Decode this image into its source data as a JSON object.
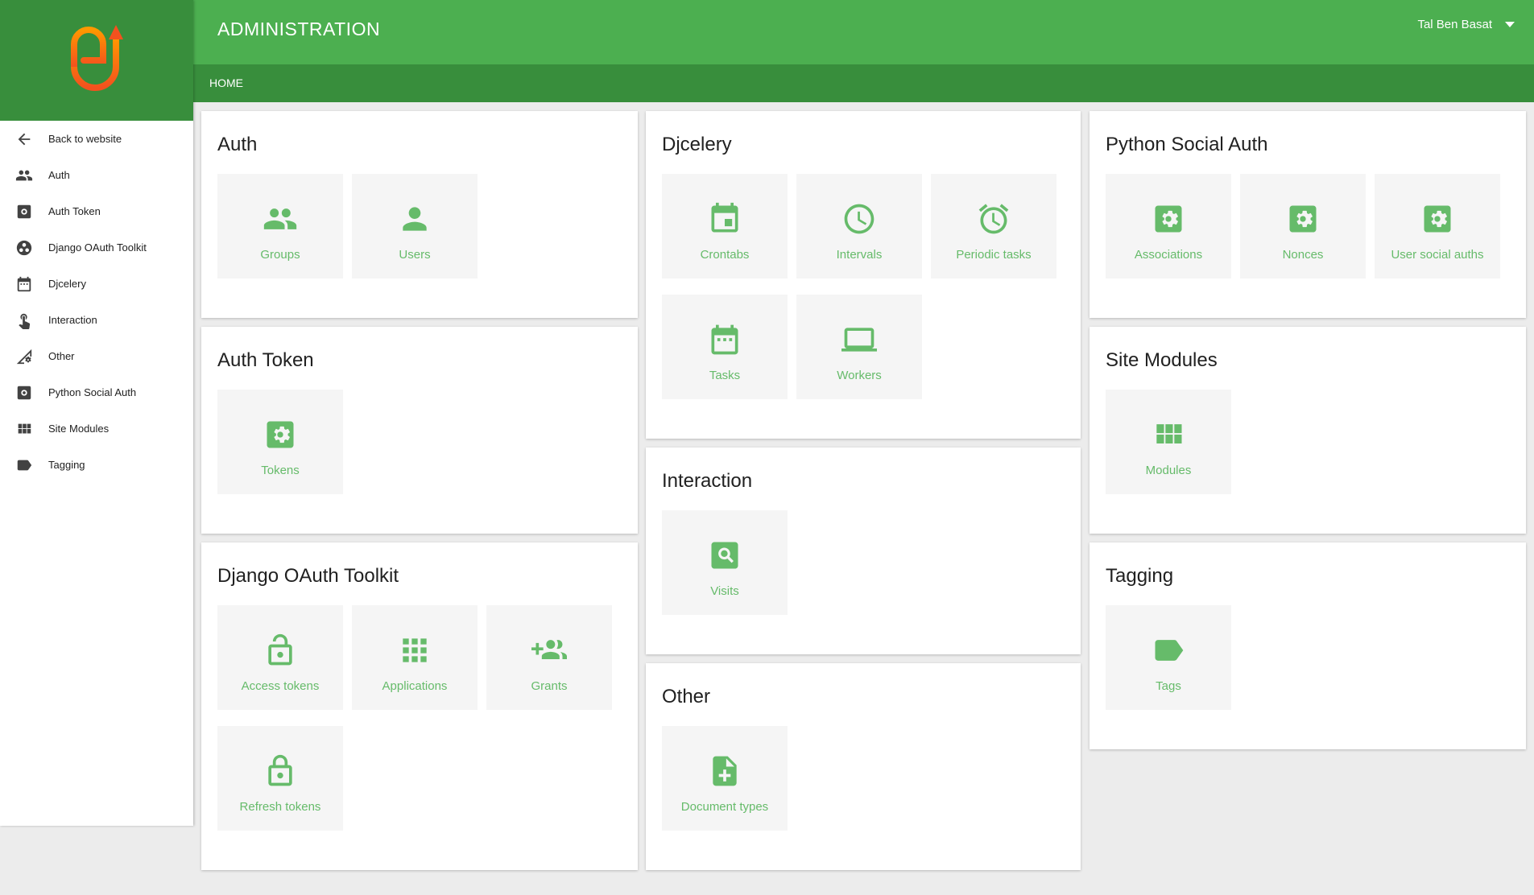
{
  "colors": {
    "header": "#4caf50",
    "subbar": "#388e3c",
    "accent": "#66bb6a",
    "tile_bg": "#f5f5f5",
    "page_bg": "#ececec"
  },
  "header": {
    "title": "ADMINISTRATION",
    "user_name": "Tal Ben Basat"
  },
  "breadcrumb": {
    "home": "HOME"
  },
  "sidebar": {
    "items": [
      {
        "label": "Back to website",
        "icon": "arrow-back-icon"
      },
      {
        "label": "Auth",
        "icon": "people-icon"
      },
      {
        "label": "Auth Token",
        "icon": "settings-box-icon"
      },
      {
        "label": "Django OAuth Toolkit",
        "icon": "group-work-icon"
      },
      {
        "label": "Djcelery",
        "icon": "calendar-icon"
      },
      {
        "label": "Interaction",
        "icon": "touch-icon"
      },
      {
        "label": "Other",
        "icon": "signal-settings-icon"
      },
      {
        "label": "Python Social Auth",
        "icon": "settings-box-icon"
      },
      {
        "label": "Site Modules",
        "icon": "grid-icon"
      },
      {
        "label": "Tagging",
        "icon": "label-icon"
      }
    ]
  },
  "apps": {
    "auth": {
      "title": "Auth",
      "models": [
        "Groups",
        "Users"
      ]
    },
    "auth_token": {
      "title": "Auth Token",
      "models": [
        "Tokens"
      ]
    },
    "oauth": {
      "title": "Django OAuth Toolkit",
      "models": [
        "Access tokens",
        "Applications",
        "Grants",
        "Refresh tokens"
      ]
    },
    "djcelery": {
      "title": "Djcelery",
      "models": [
        "Crontabs",
        "Intervals",
        "Periodic tasks",
        "Tasks",
        "Workers"
      ]
    },
    "interaction": {
      "title": "Interaction",
      "models": [
        "Visits"
      ]
    },
    "other": {
      "title": "Other",
      "models": [
        "Document types"
      ]
    },
    "psa": {
      "title": "Python Social Auth",
      "models": [
        "Associations",
        "Nonces",
        "User social auths"
      ]
    },
    "site_modules": {
      "title": "Site Modules",
      "models": [
        "Modules"
      ]
    },
    "tagging": {
      "title": "Tagging",
      "models": [
        "Tags"
      ]
    }
  }
}
